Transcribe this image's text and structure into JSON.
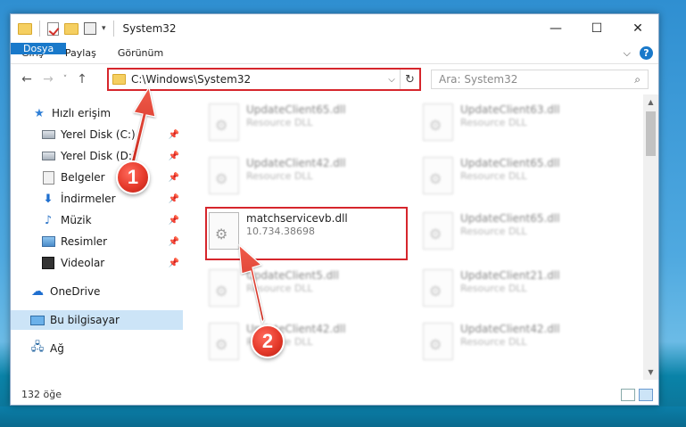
{
  "window": {
    "title": "System32",
    "controls": {
      "minimize": "—",
      "maximize": "☐",
      "close": "✕"
    }
  },
  "ribbon": {
    "tabs": [
      "Dosya",
      "Giriş",
      "Paylaş",
      "Görünüm"
    ],
    "collapse_icon": "chevron-down-icon",
    "help": "?"
  },
  "navigation": {
    "back": "←",
    "forward": "→",
    "recent": "˅",
    "up": "↑",
    "address": "C:\\Windows\\System32",
    "address_dropdown": "⌵",
    "refresh": "↻",
    "search_placeholder": "Ara: System32",
    "search_icon": "⌕"
  },
  "sidebar": {
    "items": [
      {
        "label": "Hızlı erişim",
        "icon": "star-icon",
        "pinned": false
      },
      {
        "label": "Yerel Disk (C:)",
        "icon": "disk-icon",
        "pinned": true
      },
      {
        "label": "Yerel Disk (D:)",
        "icon": "disk-icon",
        "pinned": true
      },
      {
        "label": "Belgeler",
        "icon": "documents-icon",
        "pinned": true
      },
      {
        "label": "İndirmeler",
        "icon": "download-icon",
        "pinned": true
      },
      {
        "label": "Müzik",
        "icon": "music-icon",
        "pinned": true
      },
      {
        "label": "Resimler",
        "icon": "pictures-icon",
        "pinned": true
      },
      {
        "label": "Videolar",
        "icon": "video-icon",
        "pinned": true
      },
      {
        "label": "OneDrive",
        "icon": "cloud-icon",
        "pinned": false
      },
      {
        "label": "Bu bilgisayar",
        "icon": "computer-icon",
        "pinned": false,
        "selected": true
      },
      {
        "label": "Ağ",
        "icon": "network-icon",
        "pinned": false
      }
    ],
    "pin_glyph": "📌"
  },
  "files": {
    "left_column": [
      {
        "name": "UpdateClient65.dll",
        "desc": "Resource DLL",
        "blurred": true
      },
      {
        "name": "UpdateClient42.dll",
        "desc": "Resource DLL",
        "blurred": true
      },
      {
        "name": "matchservicevb.dll",
        "desc": "10.734.38698",
        "blurred": false
      },
      {
        "name": "UpdateClient5.dll",
        "desc": "Resource DLL",
        "blurred": true
      },
      {
        "name": "UpdateClient42.dll",
        "desc": "Resource DLL",
        "blurred": true
      }
    ],
    "right_column": [
      {
        "name": "UpdateClient63.dll",
        "desc": "Resource DLL",
        "blurred": true
      },
      {
        "name": "UpdateClient65.dll",
        "desc": "Resource DLL",
        "blurred": true
      },
      {
        "name": "UpdateClient65.dll",
        "desc": "Resource DLL",
        "blurred": true
      },
      {
        "name": "UpdateClient21.dll",
        "desc": "Resource DLL",
        "blurred": true
      },
      {
        "name": "UpdateClient42.dll",
        "desc": "Resource DLL",
        "blurred": true
      }
    ]
  },
  "status": {
    "item_count": "132 öğe"
  },
  "callouts": [
    {
      "number": "1"
    },
    {
      "number": "2"
    }
  ],
  "colors": {
    "accent": "#1979ca",
    "highlight": "#d6262c",
    "selected_bg": "#cce4f7"
  }
}
